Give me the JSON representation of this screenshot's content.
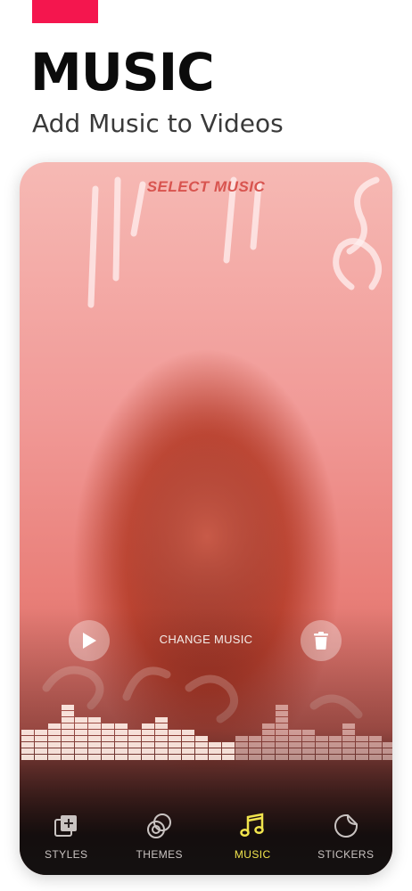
{
  "hero": {
    "title": "MUSIC",
    "subtitle": "Add Music to Videos"
  },
  "editor": {
    "header": "SELECT MUSIC",
    "change_music_label": "CHANGE MUSIC",
    "play_icon": "play-icon",
    "delete_icon": "trash-icon"
  },
  "tabs": [
    {
      "label": "STYLES",
      "icon": "styles-icon",
      "active": false
    },
    {
      "label": "THEMES",
      "icon": "themes-icon",
      "active": false
    },
    {
      "label": "MUSIC",
      "icon": "music-note-icon",
      "active": true
    },
    {
      "label": "STICKERS",
      "icon": "sticker-icon",
      "active": false
    }
  ],
  "colors": {
    "accent_bar": "#f4164e",
    "active_tab": "#f1e44d",
    "select_music_text": "#d8544f"
  }
}
